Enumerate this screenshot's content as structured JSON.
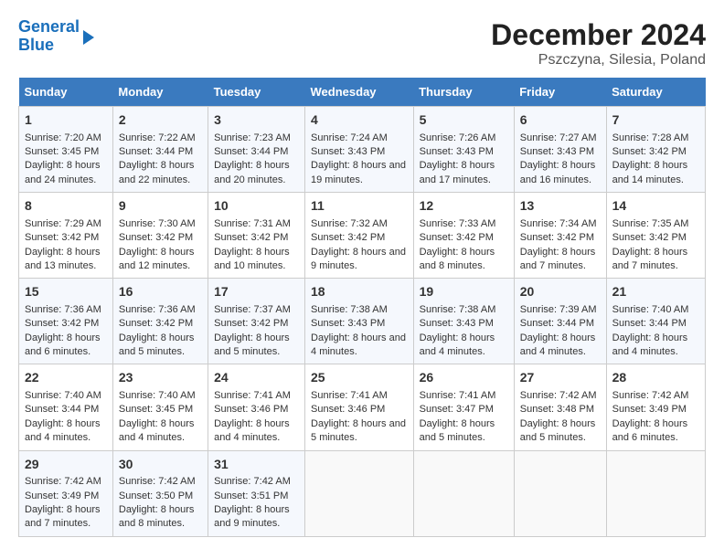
{
  "logo": {
    "line1": "General",
    "line2": "Blue"
  },
  "title": "December 2024",
  "subtitle": "Pszczyna, Silesia, Poland",
  "days_of_week": [
    "Sunday",
    "Monday",
    "Tuesday",
    "Wednesday",
    "Thursday",
    "Friday",
    "Saturday"
  ],
  "weeks": [
    [
      {
        "day": "1",
        "sunrise": "7:20 AM",
        "sunset": "3:45 PM",
        "daylight": "8 hours and 24 minutes."
      },
      {
        "day": "2",
        "sunrise": "7:22 AM",
        "sunset": "3:44 PM",
        "daylight": "8 hours and 22 minutes."
      },
      {
        "day": "3",
        "sunrise": "7:23 AM",
        "sunset": "3:44 PM",
        "daylight": "8 hours and 20 minutes."
      },
      {
        "day": "4",
        "sunrise": "7:24 AM",
        "sunset": "3:43 PM",
        "daylight": "8 hours and 19 minutes."
      },
      {
        "day": "5",
        "sunrise": "7:26 AM",
        "sunset": "3:43 PM",
        "daylight": "8 hours and 17 minutes."
      },
      {
        "day": "6",
        "sunrise": "7:27 AM",
        "sunset": "3:43 PM",
        "daylight": "8 hours and 16 minutes."
      },
      {
        "day": "7",
        "sunrise": "7:28 AM",
        "sunset": "3:42 PM",
        "daylight": "8 hours and 14 minutes."
      }
    ],
    [
      {
        "day": "8",
        "sunrise": "7:29 AM",
        "sunset": "3:42 PM",
        "daylight": "8 hours and 13 minutes."
      },
      {
        "day": "9",
        "sunrise": "7:30 AM",
        "sunset": "3:42 PM",
        "daylight": "8 hours and 12 minutes."
      },
      {
        "day": "10",
        "sunrise": "7:31 AM",
        "sunset": "3:42 PM",
        "daylight": "8 hours and 10 minutes."
      },
      {
        "day": "11",
        "sunrise": "7:32 AM",
        "sunset": "3:42 PM",
        "daylight": "8 hours and 9 minutes."
      },
      {
        "day": "12",
        "sunrise": "7:33 AM",
        "sunset": "3:42 PM",
        "daylight": "8 hours and 8 minutes."
      },
      {
        "day": "13",
        "sunrise": "7:34 AM",
        "sunset": "3:42 PM",
        "daylight": "8 hours and 7 minutes."
      },
      {
        "day": "14",
        "sunrise": "7:35 AM",
        "sunset": "3:42 PM",
        "daylight": "8 hours and 7 minutes."
      }
    ],
    [
      {
        "day": "15",
        "sunrise": "7:36 AM",
        "sunset": "3:42 PM",
        "daylight": "8 hours and 6 minutes."
      },
      {
        "day": "16",
        "sunrise": "7:36 AM",
        "sunset": "3:42 PM",
        "daylight": "8 hours and 5 minutes."
      },
      {
        "day": "17",
        "sunrise": "7:37 AM",
        "sunset": "3:42 PM",
        "daylight": "8 hours and 5 minutes."
      },
      {
        "day": "18",
        "sunrise": "7:38 AM",
        "sunset": "3:43 PM",
        "daylight": "8 hours and 4 minutes."
      },
      {
        "day": "19",
        "sunrise": "7:38 AM",
        "sunset": "3:43 PM",
        "daylight": "8 hours and 4 minutes."
      },
      {
        "day": "20",
        "sunrise": "7:39 AM",
        "sunset": "3:44 PM",
        "daylight": "8 hours and 4 minutes."
      },
      {
        "day": "21",
        "sunrise": "7:40 AM",
        "sunset": "3:44 PM",
        "daylight": "8 hours and 4 minutes."
      }
    ],
    [
      {
        "day": "22",
        "sunrise": "7:40 AM",
        "sunset": "3:44 PM",
        "daylight": "8 hours and 4 minutes."
      },
      {
        "day": "23",
        "sunrise": "7:40 AM",
        "sunset": "3:45 PM",
        "daylight": "8 hours and 4 minutes."
      },
      {
        "day": "24",
        "sunrise": "7:41 AM",
        "sunset": "3:46 PM",
        "daylight": "8 hours and 4 minutes."
      },
      {
        "day": "25",
        "sunrise": "7:41 AM",
        "sunset": "3:46 PM",
        "daylight": "8 hours and 5 minutes."
      },
      {
        "day": "26",
        "sunrise": "7:41 AM",
        "sunset": "3:47 PM",
        "daylight": "8 hours and 5 minutes."
      },
      {
        "day": "27",
        "sunrise": "7:42 AM",
        "sunset": "3:48 PM",
        "daylight": "8 hours and 5 minutes."
      },
      {
        "day": "28",
        "sunrise": "7:42 AM",
        "sunset": "3:49 PM",
        "daylight": "8 hours and 6 minutes."
      }
    ],
    [
      {
        "day": "29",
        "sunrise": "7:42 AM",
        "sunset": "3:49 PM",
        "daylight": "8 hours and 7 minutes."
      },
      {
        "day": "30",
        "sunrise": "7:42 AM",
        "sunset": "3:50 PM",
        "daylight": "8 hours and 8 minutes."
      },
      {
        "day": "31",
        "sunrise": "7:42 AM",
        "sunset": "3:51 PM",
        "daylight": "8 hours and 9 minutes."
      },
      null,
      null,
      null,
      null
    ]
  ]
}
